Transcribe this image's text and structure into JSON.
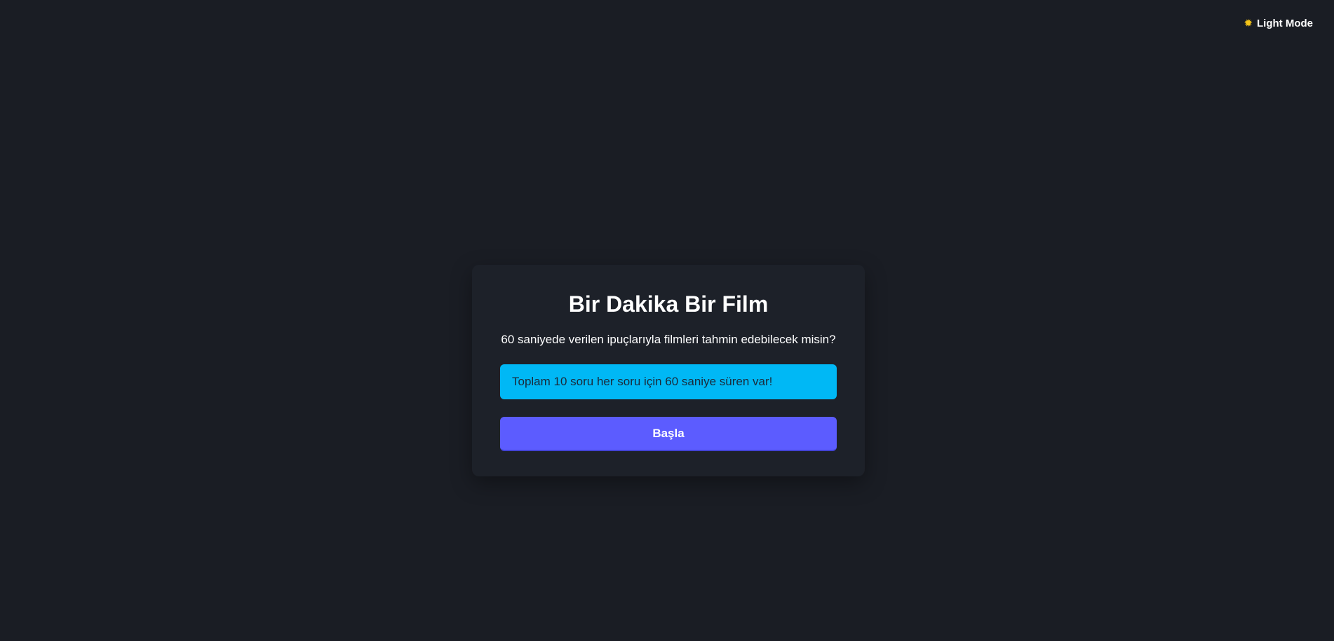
{
  "theme_toggle": {
    "icon": "sun-icon",
    "icon_glyph": "✹",
    "label": "Light Mode"
  },
  "card": {
    "title": "Bir Dakika Bir Film",
    "subtitle": "60 saniyede verilen ipuçlarıyla filmleri tahmin edebilecek misin?",
    "info": "Toplam 10 soru her soru için 60 saniye süren var!",
    "start_label": "Başla"
  },
  "colors": {
    "background": "#1a1d24",
    "card": "#1d2129",
    "info_box": "#00b8f5",
    "start_button": "#5c5cff",
    "sun_icon": "#f5c518"
  }
}
